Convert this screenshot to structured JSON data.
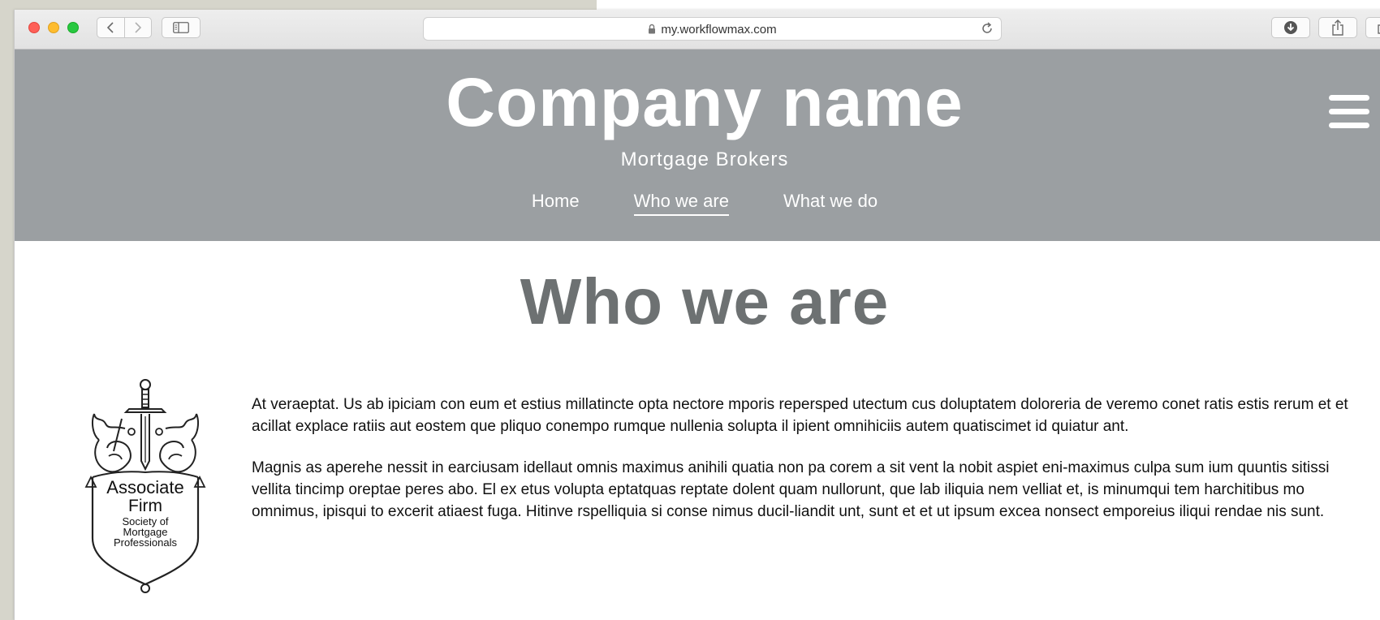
{
  "browser": {
    "url": "my.workflowmax.com"
  },
  "site": {
    "company_name": "Company name",
    "tagline": "Mortgage Brokers",
    "nav": [
      {
        "label": "Home",
        "active": false
      },
      {
        "label": "Who we are",
        "active": true
      },
      {
        "label": "What we do",
        "active": false
      }
    ]
  },
  "page": {
    "title": "Who we are",
    "badge": {
      "line1": "Associate",
      "line2": "Firm",
      "line3": "Society of",
      "line4": "Mortgage",
      "line5": "Professionals"
    },
    "paragraphs": [
      "At veraeptat. Us ab ipiciam con eum et estius millatincte opta nectore mporis repersped utectum cus doluptatem doloreria de veremo conet ratis estis rerum et et acillat explace ratiis aut eostem que pliquo conempo rumque nullenia solupta il ipient omnihiciis autem quatiscimet id quiatur ant.",
      "Magnis as aperehe nessit in earciusam idellaut omnis maximus anihili quatia non pa corem a sit vent la nobit aspiet eni-maximus culpa sum ium quuntis sitissi vellita tincimp oreptae peres abo. El ex etus volupta eptatquas reptate dolent quam nullorunt, que lab iliquia nem velliat et, is minumqui tem harchitibus mo omnimus, ipisqui to excerit atiaest fuga. Hitinve rspelliquia si conse nimus ducil-liandit unt, sunt et et ut ipsum excea nonsect emporeius iliqui rendae nis sunt."
    ]
  },
  "icons": {
    "back": "chevron-left-icon",
    "forward": "chevron-right-icon",
    "sidebar": "sidebar-icon",
    "lock": "lock-icon",
    "reload": "reload-icon",
    "download": "download-icon",
    "share": "share-icon",
    "tabs": "tabs-icon",
    "menu": "hamburger-menu-icon"
  },
  "colors": {
    "header_bg": "#9b9fa2",
    "title_gray": "#6d7172"
  }
}
